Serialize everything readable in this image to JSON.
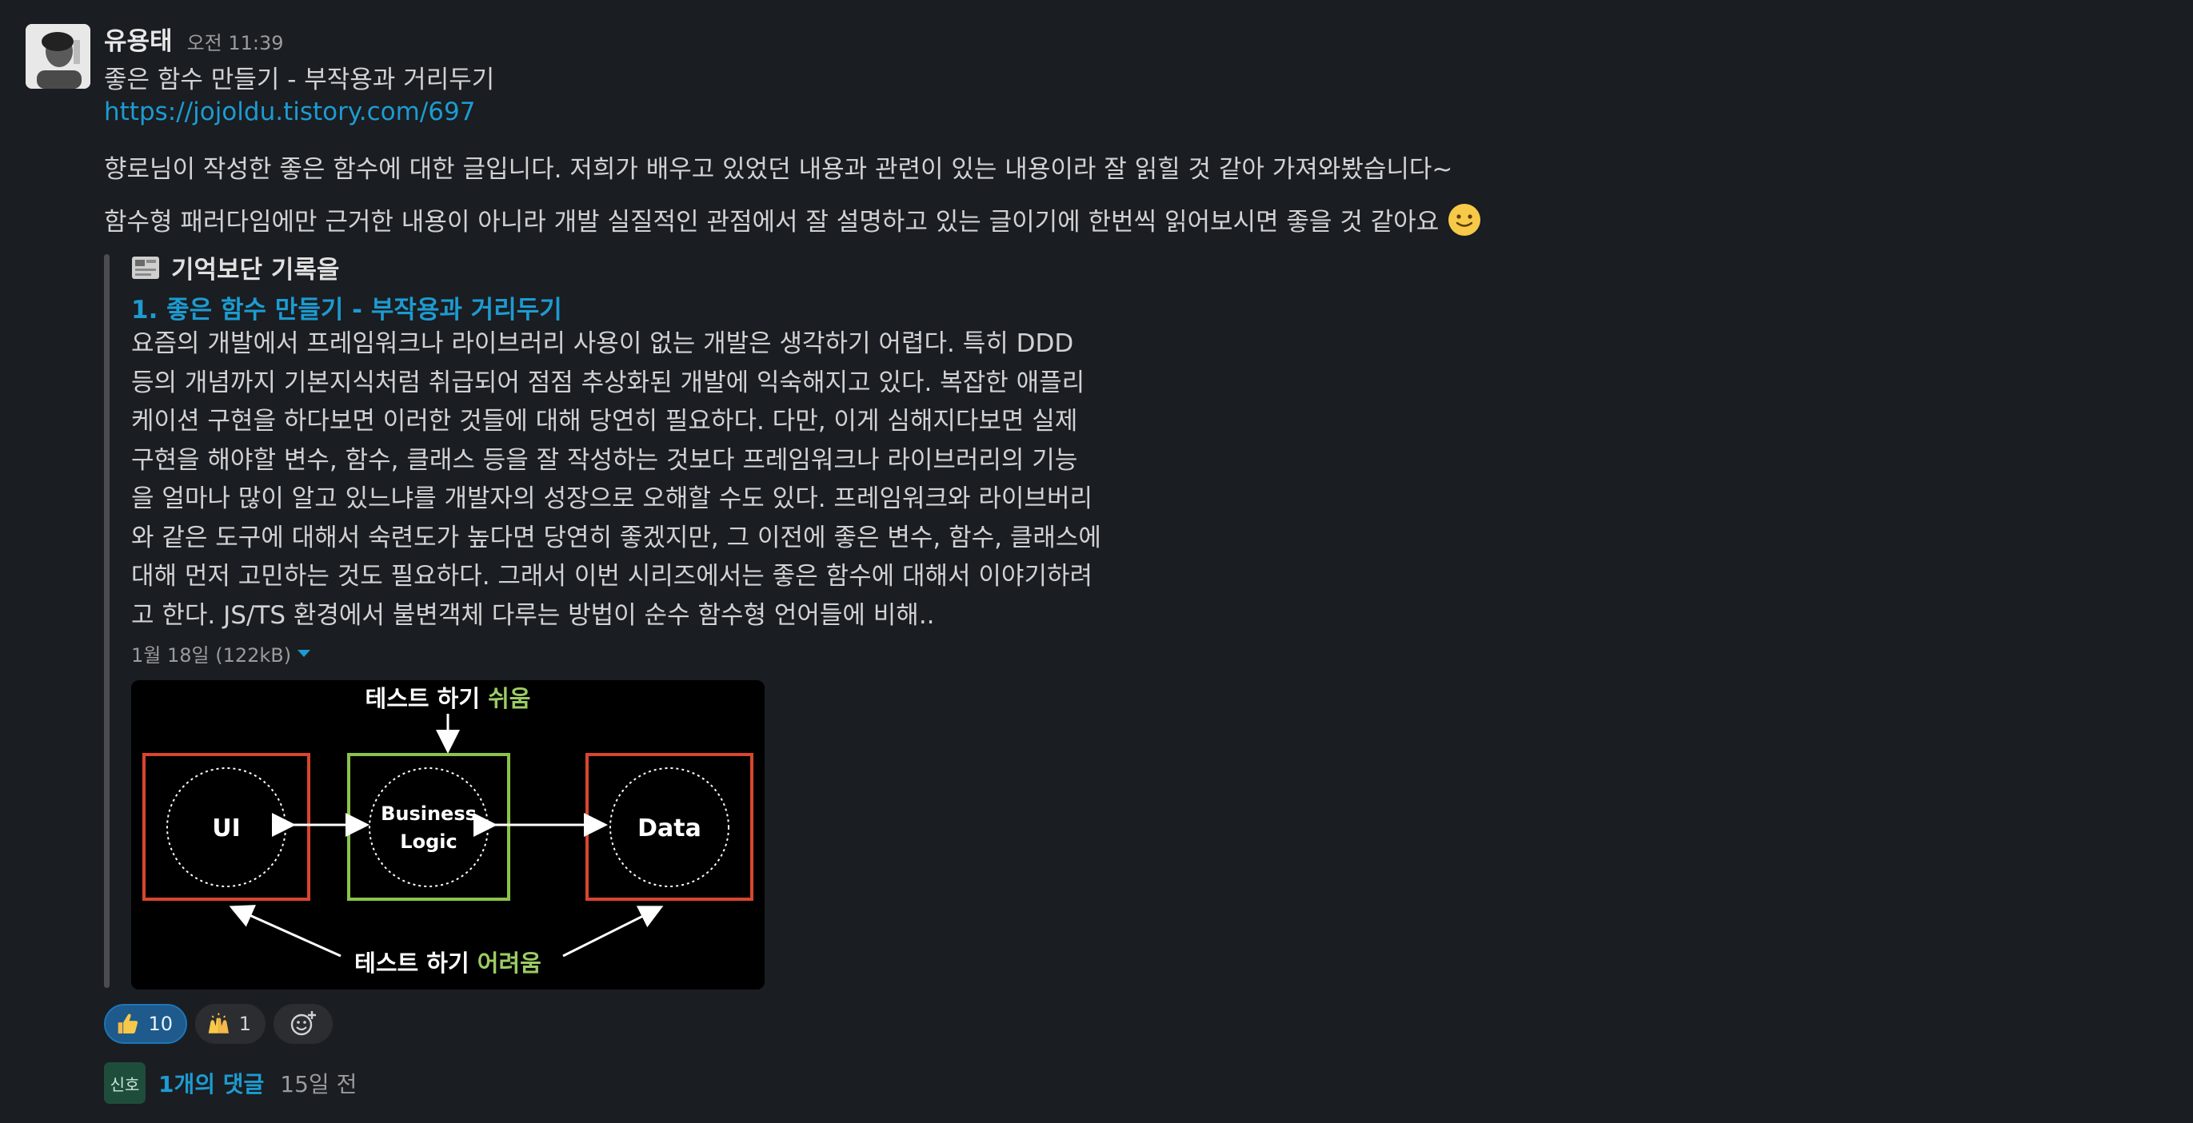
{
  "message": {
    "author": "유용태",
    "time": "오전 11:39",
    "title": "좋은 함수 만들기 - 부작용과 거리두기",
    "link": "https://jojoldu.tistory.com/697",
    "paragraph1": "향로님이 작성한 좋은 함수에 대한 글입니다. 저희가 배우고 있었던 내용과 관련이 있는 내용이라 잘 읽힐 것 같아 가져와봤습니다~",
    "paragraph2": "함수형 패러다임에만 근거한 내용이 아니라 개발 실질적인 관점에서 잘 설명하고 있는 글이기에 한번씩 읽어보시면 좋을 것 같아요"
  },
  "attachment": {
    "site_name": "기억보단 기록을",
    "title": "1. 좋은 함수 만들기 - 부작용과 거리두기",
    "body_lines": [
      "요즘의 개발에서 프레임워크나 라이브러리 사용이 없는 개발은 생각하기 어렵다. 특히 DDD",
      "등의 개념까지 기본지식처럼 취급되어 점점 추상화된 개발에 익숙해지고 있다. 복잡한 애플리",
      "케이션 구현을 하다보면 이러한 것들에 대해 당연히 필요하다. 다만, 이게 심해지다보면 실제",
      "구현을 해야할 변수, 함수, 클래스 등을 잘 작성하는 것보다 프레임워크나 라이브러리의 기능",
      "을 얼마나 많이 알고 있느냐를 개발자의 성장으로 오해할 수도 있다. 프레임워크와 라이브버리",
      "와 같은 도구에 대해서 숙련도가 높다면 당연히 좋겠지만, 그 이전에 좋은 변수, 함수, 클래스에",
      "대해 먼저 고민하는 것도 필요하다. 그래서 이번 시리즈에서는 좋은 함수에 대해서 이야기하려",
      "고 한다. JS/TS 환경에서 불변객체 다루는 방법이 순수 함수형 언어들에 비해.."
    ],
    "meta": "1월 18일 (122kB)",
    "image": {
      "top_label_prefix": "테스트 하기 ",
      "top_label_highlight": "쉬움",
      "bottom_label_prefix": "테스트 하기 ",
      "bottom_label_highlight": "어려움",
      "box_left": "UI",
      "box_middle_line1": "Business",
      "box_middle_line2": "Logic",
      "box_right": "Data",
      "colors": {
        "red_box": "#d9452f",
        "green_box": "#8bc34a",
        "highlight": "#9ccc65"
      }
    }
  },
  "reactions": [
    {
      "emoji": "thumbs-up",
      "count": "10",
      "active": true
    },
    {
      "emoji": "raising-hands",
      "count": "1",
      "active": false
    }
  ],
  "thread": {
    "avatar_text": "신호",
    "reply_count": "1개의 댓글",
    "ago": "15일 전"
  },
  "colors": {
    "background": "#1a1d21",
    "link": "#1d9bd1",
    "text": "#d1d2d3"
  }
}
